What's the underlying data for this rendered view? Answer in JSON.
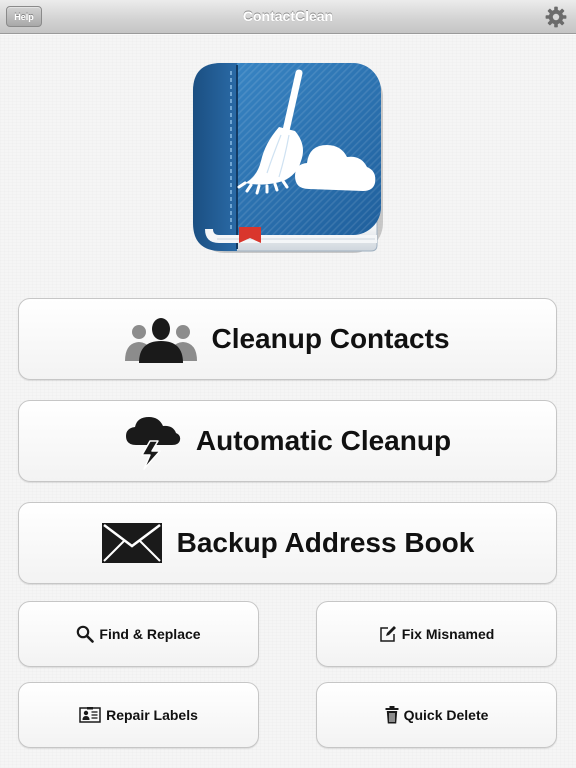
{
  "nav": {
    "title": "ContactClean",
    "help_label": "Help",
    "settings_icon": "gear-icon"
  },
  "app_icon": {
    "icon": "book-broom-cloud-icon"
  },
  "buttons": {
    "cleanup_contacts": {
      "label": "Cleanup Contacts",
      "icon": "people-group-icon"
    },
    "automatic_cleanup": {
      "label": "Automatic Cleanup",
      "icon": "storm-cloud-icon"
    },
    "backup_address_book": {
      "label": "Backup Address Book",
      "icon": "envelope-icon"
    },
    "find_replace": {
      "label": "Find & Replace",
      "icon": "search-icon"
    },
    "fix_misnamed": {
      "label": "Fix Misnamed",
      "icon": "edit-icon"
    },
    "repair_labels": {
      "label": "Repair Labels",
      "icon": "contact-card-icon"
    },
    "quick_delete": {
      "label": "Quick Delete",
      "icon": "trash-icon"
    }
  },
  "colors": {
    "navbar_text": "#ffffff",
    "button_text": "#111111",
    "book_blue": "#2f79b8",
    "bookmark_red": "#d9362c"
  }
}
